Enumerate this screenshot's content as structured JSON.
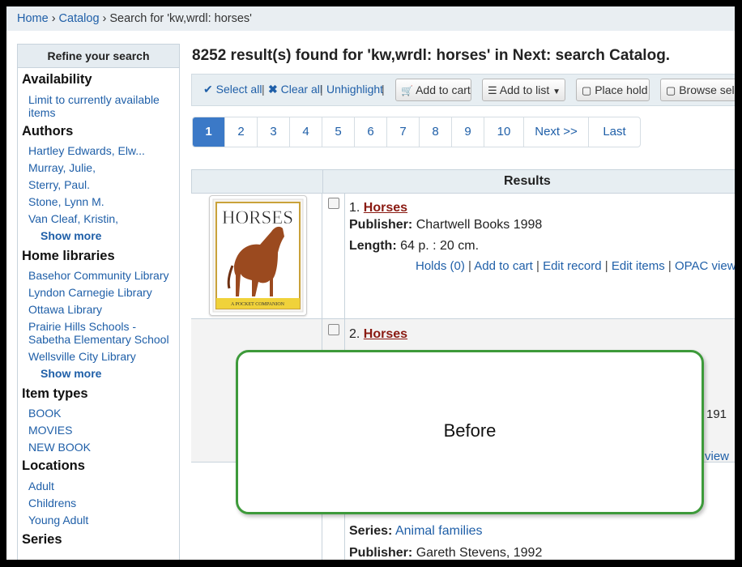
{
  "breadcrumb": [
    {
      "label": "Home",
      "link": true
    },
    {
      "label": "Catalog",
      "link": true
    },
    {
      "label": "Search for 'kw,wrdl: horses'",
      "link": false
    }
  ],
  "sidebar": {
    "title": "Refine your search",
    "sections": [
      {
        "heading": "Availability",
        "items": [
          "Limit to currently available items"
        ],
        "show_more": null
      },
      {
        "heading": "Authors",
        "items": [
          "Hartley Edwards, Elw...",
          "Murray, Julie,",
          "Sterry, Paul.",
          "Stone, Lynn M.",
          "Van Cleaf, Kristin,"
        ],
        "show_more": "Show more"
      },
      {
        "heading": "Home libraries",
        "items": [
          "Basehor Community Library",
          "Lyndon Carnegie Library",
          "Ottawa Library",
          "Prairie Hills Schools - Sabetha Elementary School",
          "Wellsville City Library"
        ],
        "show_more": "Show more"
      },
      {
        "heading": "Item types",
        "items": [
          "BOOK",
          "MOVIES",
          "NEW BOOK"
        ],
        "show_more": null
      },
      {
        "heading": "Locations",
        "items": [
          "Adult",
          "Childrens",
          "Young Adult"
        ],
        "show_more": null
      },
      {
        "heading": "Series",
        "items": [],
        "show_more": null
      }
    ]
  },
  "main": {
    "heading": "8252 result(s) found for 'kw,wrdl: horses' in Next: search Catalog.",
    "toolbar": {
      "select_all": "Select all",
      "clear_all": "Clear all",
      "unhighlight": "Unhighlight",
      "add_to_cart": "Add to cart",
      "add_to_list": "Add to list",
      "place_hold": "Place hold",
      "browse_selected": "Browse sele"
    },
    "pagination": [
      "1",
      "2",
      "3",
      "4",
      "5",
      "6",
      "7",
      "8",
      "9",
      "10",
      "Next >>",
      "Last"
    ],
    "current_page": "1",
    "results_header": "Results",
    "results": [
      {
        "number": "1.",
        "title": "Horses",
        "publisher_label": "Publisher:",
        "publisher": "Chartwell Books 1998",
        "length_label": "Length:",
        "length": "64 p. : 20 cm.",
        "actions": [
          "Holds (0)",
          "Add to cart",
          "Edit record",
          "Edit items",
          "OPAC view"
        ],
        "cover_title": "HORSES",
        "cover_caption": "A POCKET COMPANION"
      },
      {
        "number": "2.",
        "title": "Horses",
        "partial_text": "191",
        "partial_action": "view"
      },
      {
        "series_label": "Series:",
        "series": "Animal families",
        "publisher_label": "Publisher:",
        "publisher": "Gareth Stevens, 1992"
      }
    ]
  },
  "callout": {
    "text": "Before"
  }
}
